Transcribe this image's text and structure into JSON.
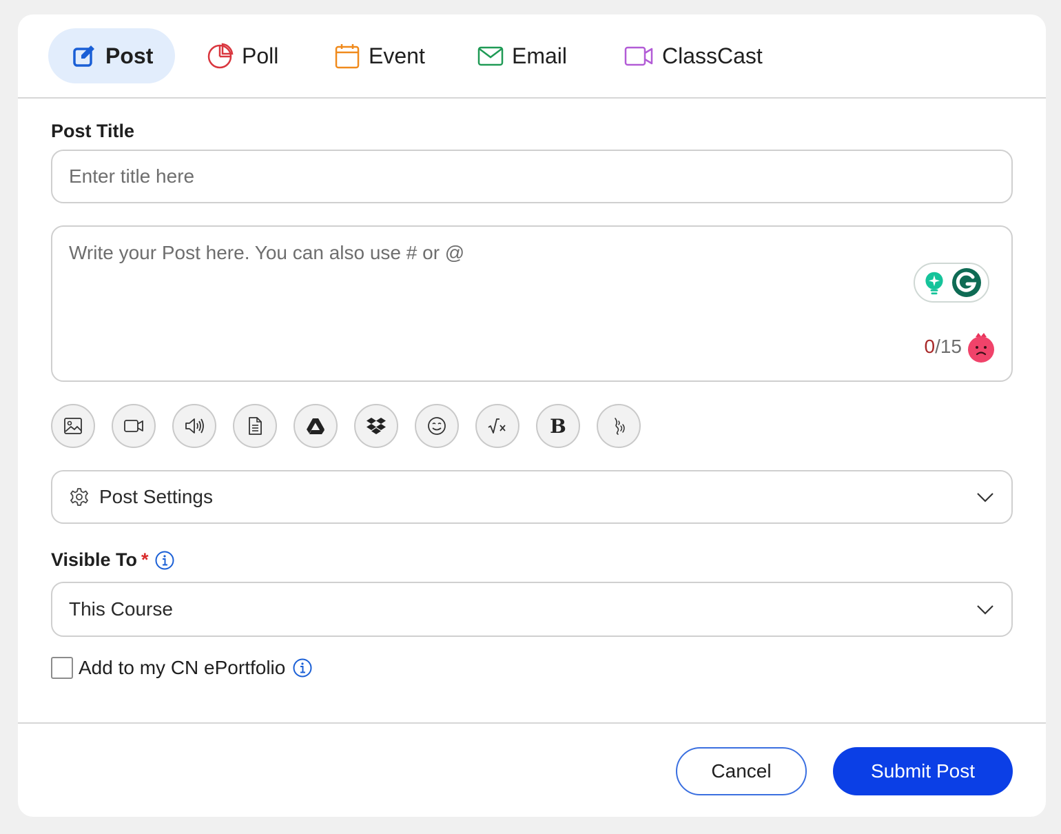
{
  "tabs": [
    {
      "label": "Post",
      "icon": "edit-icon",
      "color": "#1a5fd6",
      "active": true
    },
    {
      "label": "Poll",
      "icon": "pie-chart-icon",
      "color": "#d9363e"
    },
    {
      "label": "Event",
      "icon": "calendar-icon",
      "color": "#f08a1c"
    },
    {
      "label": "Email",
      "icon": "envelope-icon",
      "color": "#1f9a55"
    },
    {
      "label": "ClassCast",
      "icon": "video-icon",
      "color": "#b25bd6"
    }
  ],
  "post_title": {
    "label": "Post Title",
    "placeholder": "Enter title here",
    "value": ""
  },
  "body": {
    "placeholder": "Write your Post here. You can also use # or @",
    "count_current": "0",
    "count_max": "/15"
  },
  "toolbar": [
    "image-icon",
    "video-icon",
    "audio-icon",
    "document-icon",
    "google-drive-icon",
    "dropbox-icon",
    "emoji-icon",
    "math-equation-icon",
    "bold-icon",
    "sign-language-icon"
  ],
  "toolbar_bold_glyph": "B",
  "post_settings": {
    "label": "Post Settings"
  },
  "visible_to": {
    "label": "Visible To",
    "required_mark": "*",
    "selected": "This Course"
  },
  "eportfolio": {
    "label": "Add to my CN ePortfolio",
    "checked": false
  },
  "actions": {
    "cancel": "Cancel",
    "submit": "Submit Post"
  },
  "colors": {
    "primary": "#0b3fe6",
    "active_tab_bg": "#e2edfc",
    "info_icon": "#1a5fd6",
    "grammarly": "#15c39a"
  }
}
